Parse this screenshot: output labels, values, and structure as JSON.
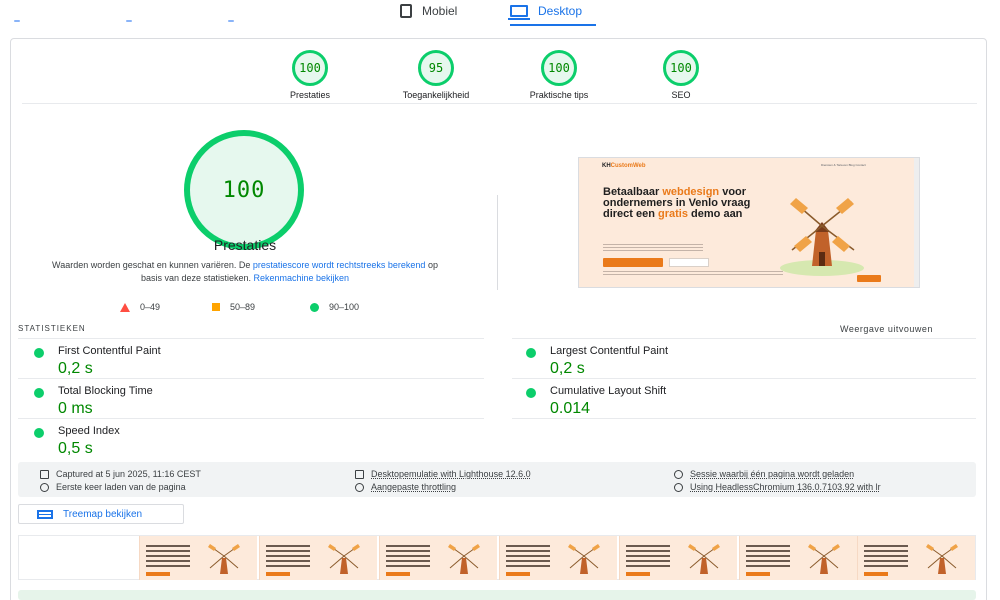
{
  "tabs": {
    "mobile": "Mobiel",
    "desktop": "Desktop"
  },
  "gauges": [
    {
      "score": "100",
      "label": "Prestaties"
    },
    {
      "score": "95",
      "label": "Toegankelijkheid"
    },
    {
      "score": "100",
      "label": "Praktische tips"
    },
    {
      "score": "100",
      "label": "SEO"
    }
  ],
  "main": {
    "score": "100",
    "title": "Prestaties",
    "desc_1": "Waarden worden geschat en kunnen variëren. De ",
    "desc_link_1": "prestatiescore wordt rechtstreeks berekend",
    "desc_2": " op basis van deze statistieken. ",
    "desc_link_2": "Rekenmachine bekijken"
  },
  "legend": {
    "fail": "0–49",
    "average": "50–89",
    "pass": "90–100"
  },
  "screenshot": {
    "brand_a": "KH",
    "brand_b": "CustomWeb",
    "nav": "Diensten & Tarieven    Blog    Contact",
    "headline_1": "Betaalbaar ",
    "headline_hl_1": "webdesign",
    "headline_2": " voor ondernemers in Venlo vraag direct een ",
    "headline_hl_2": "gratis",
    "headline_3": " demo aan"
  },
  "stats": {
    "heading": "STATISTIEKEN",
    "expand": "Weergave uitvouwen",
    "metrics": [
      {
        "name": "First Contentful Paint",
        "value": "0,2 s"
      },
      {
        "name": "Largest Contentful Paint",
        "value": "0,2 s"
      },
      {
        "name": "Total Blocking Time",
        "value": "0 ms"
      },
      {
        "name": "Cumulative Layout Shift",
        "value": "0.014"
      },
      {
        "name": "Speed Index",
        "value": "0,5 s"
      }
    ]
  },
  "info": {
    "captured": "Captured at 5 jun 2025, 11:16 CEST",
    "first_load": "Eerste keer laden van de pagina",
    "emulation": "Desktopemulatie with Lighthouse 12.6.0",
    "throttling": "Aangepaste throttling",
    "session": "Sessie waarbij één pagina wordt geladen",
    "browser": "Using HeadlessChromium 136.0.7103.92 with lr"
  },
  "treemap": {
    "label": "Treemap bekijken"
  },
  "colors": {
    "pass": "#0cce6b",
    "pass_text": "#008800",
    "average": "#ffa400",
    "fail": "#ff4e42",
    "accent": "#1a73e8",
    "brand_orange": "#ea7a1a"
  },
  "icons": {
    "mobile": "phone-icon",
    "desktop": "monitor-icon",
    "treemap": "treemap-icon"
  }
}
